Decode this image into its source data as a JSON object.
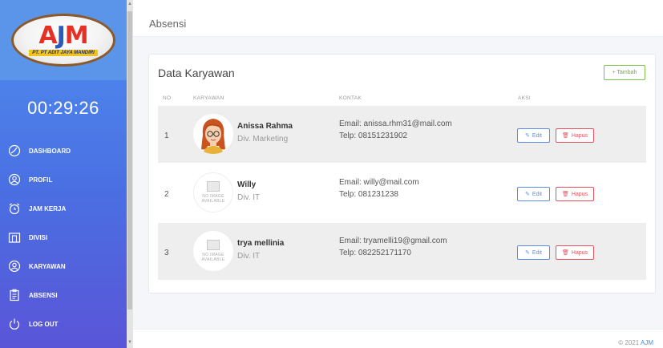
{
  "logo": {
    "letters": [
      "A",
      "J",
      "M"
    ],
    "subtitle": "PT. PT ADIT JAYA MANDIRI"
  },
  "clock": "00:29:26",
  "menu": [
    {
      "label": "DASHBOARD",
      "icon": "dashboard-icon"
    },
    {
      "label": "PROFIL",
      "icon": "profile-icon"
    },
    {
      "label": "JAM KERJA",
      "icon": "alarm-clock-icon"
    },
    {
      "label": "DIVISI",
      "icon": "building-icon"
    },
    {
      "label": "KARYAWAN",
      "icon": "employee-icon"
    },
    {
      "label": "ABSENSI",
      "icon": "clipboard-icon"
    },
    {
      "label": "LOG OUT",
      "icon": "power-icon"
    }
  ],
  "topbar": {
    "title": "Absensi"
  },
  "card": {
    "title": "Data Karyawan",
    "add_label": "+ Tambah",
    "columns": [
      "NO",
      "KARYAWAN",
      "KONTAK",
      "AKSI"
    ],
    "edit_label": "Edit",
    "delete_label": "Hapus",
    "no_image_text": "NO IMAGE AVAILABLE",
    "rows": [
      {
        "no": "1",
        "name": "Anissa Rahma",
        "division": "Div. Marketing",
        "email": "Email: anissa.rhm31@mail.com",
        "phone": "Telp: 08151231902",
        "avatar": "cartoon-woman-avatar"
      },
      {
        "no": "2",
        "name": "Willy",
        "division": "Div. IT",
        "email": "Email: willy@mail.com",
        "phone": "Telp: 081231238",
        "avatar": "no-image"
      },
      {
        "no": "3",
        "name": "trya mellinia",
        "division": "Div. IT",
        "email": "Email: tryamelli19@gmail.com",
        "phone": "Telp: 082252171170",
        "avatar": "no-image"
      }
    ]
  },
  "footer": {
    "copyright": "© 2021 ",
    "brand": "AJM"
  },
  "colors": {
    "sidebar_top": "#4f8ff0",
    "sidebar_bottom": "#5a55d8",
    "edit": "#5e8de8",
    "delete": "#e5525e",
    "add": "#7fbf4d"
  }
}
